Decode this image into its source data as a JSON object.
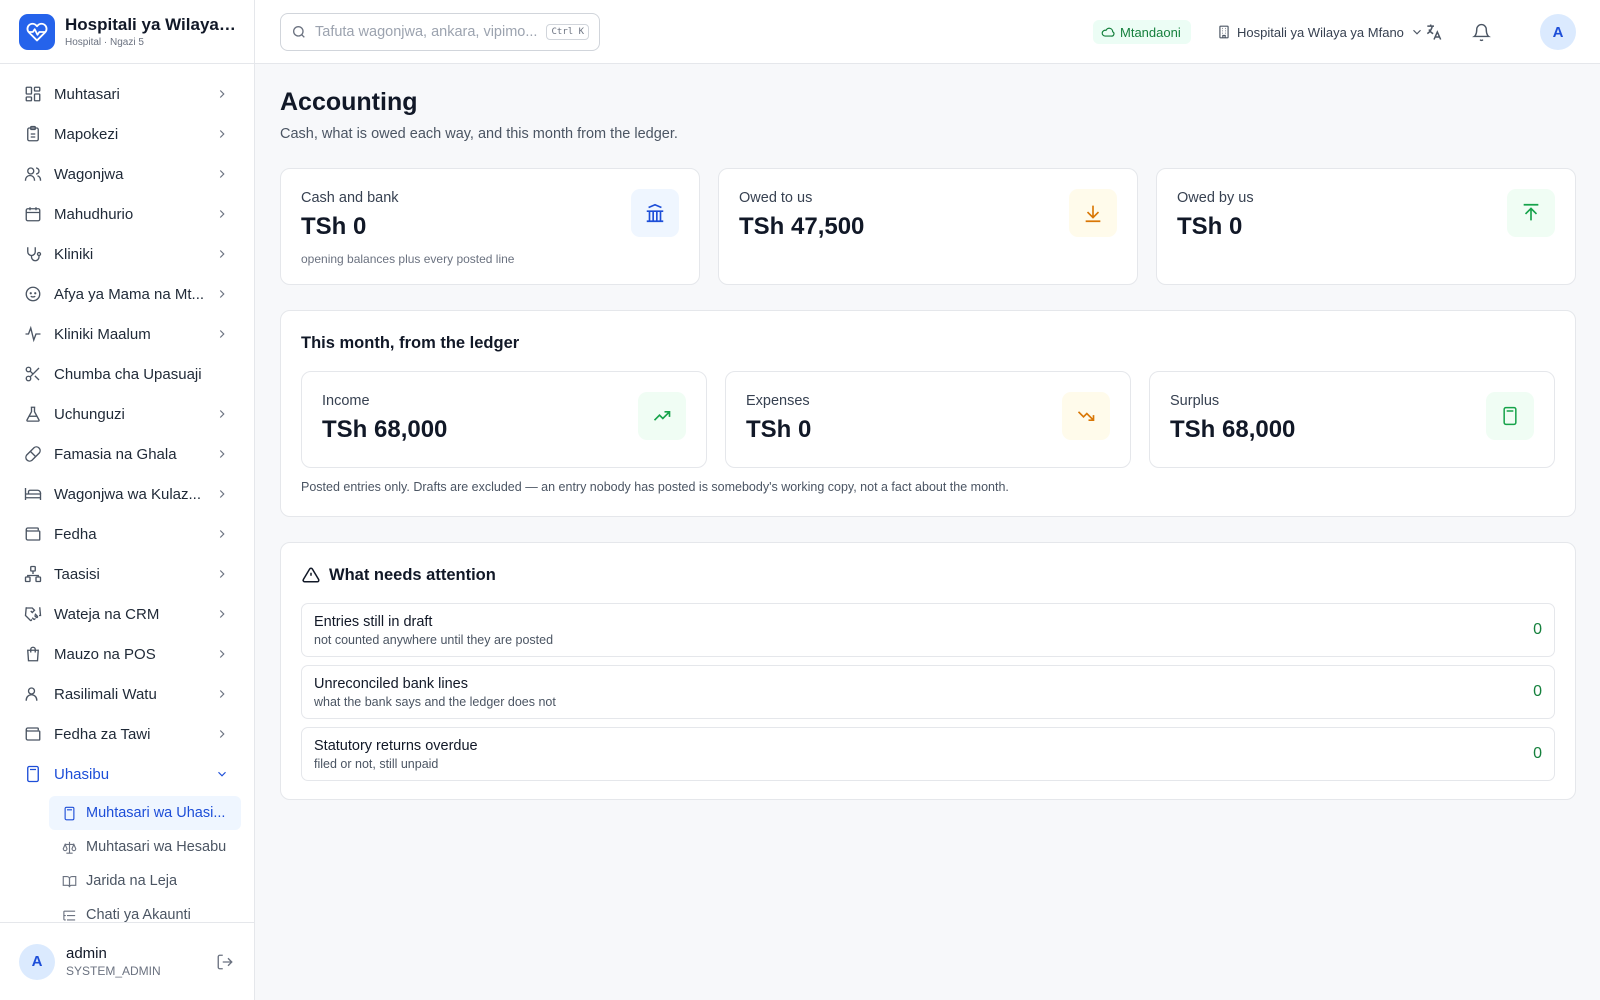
{
  "brand": {
    "title": "Hospitali ya Wilaya ...",
    "subtitle": "Hospital · Ngazi 5"
  },
  "sidebar": {
    "items": [
      {
        "label": "Muhtasari",
        "icon": "dashboard-icon",
        "chevron": "right"
      },
      {
        "label": "Mapokezi",
        "icon": "clipboard-icon",
        "chevron": "right"
      },
      {
        "label": "Wagonjwa",
        "icon": "users-icon",
        "chevron": "right"
      },
      {
        "label": "Mahudhurio",
        "icon": "calendar-icon",
        "chevron": "right"
      },
      {
        "label": "Kliniki",
        "icon": "stethoscope-icon",
        "chevron": "right"
      },
      {
        "label": "Afya ya Mama na Mt...",
        "icon": "baby-icon",
        "chevron": "right"
      },
      {
        "label": "Kliniki Maalum",
        "icon": "activity-icon",
        "chevron": "right"
      },
      {
        "label": "Chumba cha Upasuaji",
        "icon": "scissors-icon",
        "chevron": ""
      },
      {
        "label": "Uchunguzi",
        "icon": "flask-icon",
        "chevron": "right"
      },
      {
        "label": "Famasia na Ghala",
        "icon": "pill-icon",
        "chevron": "right"
      },
      {
        "label": "Wagonjwa wa Kulaz...",
        "icon": "bed-icon",
        "chevron": "right"
      },
      {
        "label": "Fedha",
        "icon": "wallet-icon",
        "chevron": "right"
      },
      {
        "label": "Taasisi",
        "icon": "network-icon",
        "chevron": "right"
      },
      {
        "label": "Wateja na CRM",
        "icon": "handshake-icon",
        "chevron": "right"
      },
      {
        "label": "Mauzo na POS",
        "icon": "shopping-bag-icon",
        "chevron": "right"
      },
      {
        "label": "Rasilimali Watu",
        "icon": "user-icon",
        "chevron": "right"
      },
      {
        "label": "Fedha za Tawi",
        "icon": "wallet-icon",
        "chevron": "right"
      },
      {
        "label": "Uhasibu",
        "icon": "calculator-icon",
        "chevron": "down",
        "active": true
      }
    ],
    "sub_items": [
      {
        "label": "Muhtasari wa Uhasi...",
        "icon": "calculator-icon",
        "active": true
      },
      {
        "label": "Muhtasari wa Hesabu",
        "icon": "scale-icon"
      },
      {
        "label": "Jarida na Leja",
        "icon": "book-icon"
      },
      {
        "label": "Chati ya Akaunti",
        "icon": "list-tree-icon"
      }
    ]
  },
  "user": {
    "initial": "A",
    "name": "admin",
    "role": "SYSTEM_ADMIN"
  },
  "topbar": {
    "search_placeholder": "Tafuta wagonjwa, ankara, vipimo...",
    "search_shortcut": "Ctrl K",
    "status": "Mtandaoni",
    "facility": "Hospitali ya Wilaya ya Mfano",
    "avatar_initial": "A"
  },
  "page": {
    "title": "Accounting",
    "subtitle": "Cash, what is owed each way, and this month from the ledger."
  },
  "summary_cards": [
    {
      "label": "Cash and bank",
      "value": "TSh 0",
      "note": "opening balances plus every posted line",
      "icon": "bank-icon"
    },
    {
      "label": "Owed to us",
      "value": "TSh 47,500",
      "note": "",
      "icon": "download-icon"
    },
    {
      "label": "Owed by us",
      "value": "TSh 0",
      "note": "",
      "icon": "upload-icon"
    }
  ],
  "ledger": {
    "title": "This month, from the ledger",
    "cards": [
      {
        "label": "Income",
        "value": "TSh 68,000",
        "icon": "trending-up-icon"
      },
      {
        "label": "Expenses",
        "value": "TSh 0",
        "icon": "trending-down-icon"
      },
      {
        "label": "Surplus",
        "value": "TSh 68,000",
        "icon": "calculator-icon"
      }
    ],
    "note": "Posted entries only. Drafts are excluded — an entry nobody has posted is somebody's working copy, not a fact about the month."
  },
  "attention": {
    "title": "What needs attention",
    "rows": [
      {
        "title": "Entries still in draft",
        "desc": "not counted anywhere until they are posted",
        "count": "0"
      },
      {
        "title": "Unreconciled bank lines",
        "desc": "what the bank says and the ledger does not",
        "count": "0"
      },
      {
        "title": "Statutory returns overdue",
        "desc": "filed or not, still unpaid",
        "count": "0"
      }
    ]
  },
  "colors": {
    "accent": "#2563eb",
    "success": "#15803d",
    "warning": "#d97706"
  }
}
